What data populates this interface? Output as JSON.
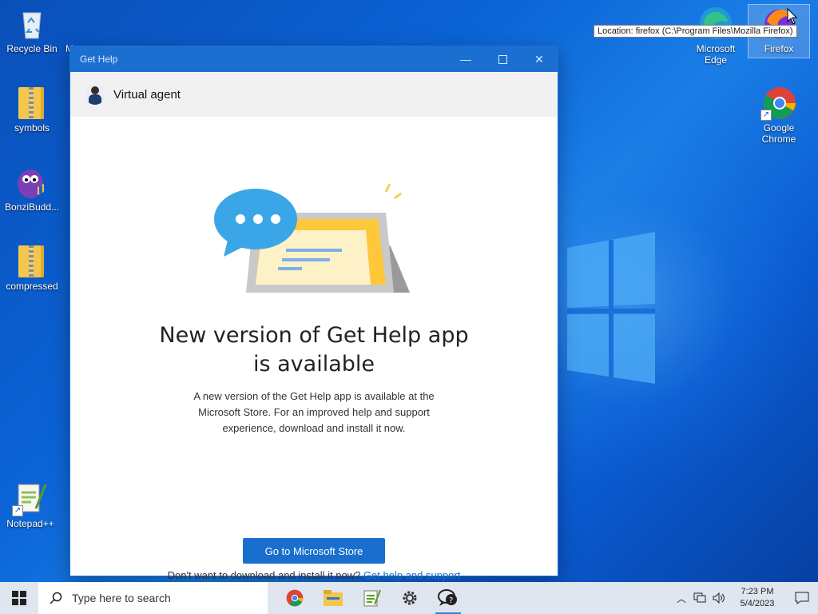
{
  "desktop": {
    "icons_left": [
      {
        "label": "Recycle Bin"
      },
      {
        "label": "M"
      },
      {
        "label": "symbols"
      },
      {
        "label": "BonziBudd..."
      },
      {
        "label": "compressed"
      },
      {
        "label": "Notepad++"
      }
    ],
    "icons_right": [
      {
        "label": "Microsoft Edge"
      },
      {
        "label": "Firefox"
      },
      {
        "label": "Google Chrome"
      }
    ],
    "tooltip": "Location: firefox (C:\\Program Files\\Mozilla Firefox)"
  },
  "window": {
    "title": "Get Help",
    "agent_label": "Virtual agent",
    "headline_line1": "New version of Get Help app",
    "headline_line2": "is available",
    "para_line1": "A new version of the Get Help app is available at the",
    "para_line2": "Microsoft Store. For an improved help and support",
    "para_line3": "experience, download and install it now.",
    "store_button": "Go to Microsoft Store",
    "foot_text": "Don't want to download and install it now? ",
    "foot_link": "Get help and support online"
  },
  "taskbar": {
    "search_placeholder": "Type here to search",
    "time": "7:23 PM",
    "date": "5/4/2023",
    "apps": [
      "chrome-icon",
      "file-explorer-icon",
      "notepad-icon",
      "settings-icon",
      "get-help-icon"
    ]
  },
  "colors": {
    "accent": "#1b6fd0",
    "button": "#1a6fce",
    "taskbar": "#dfe6ef"
  }
}
